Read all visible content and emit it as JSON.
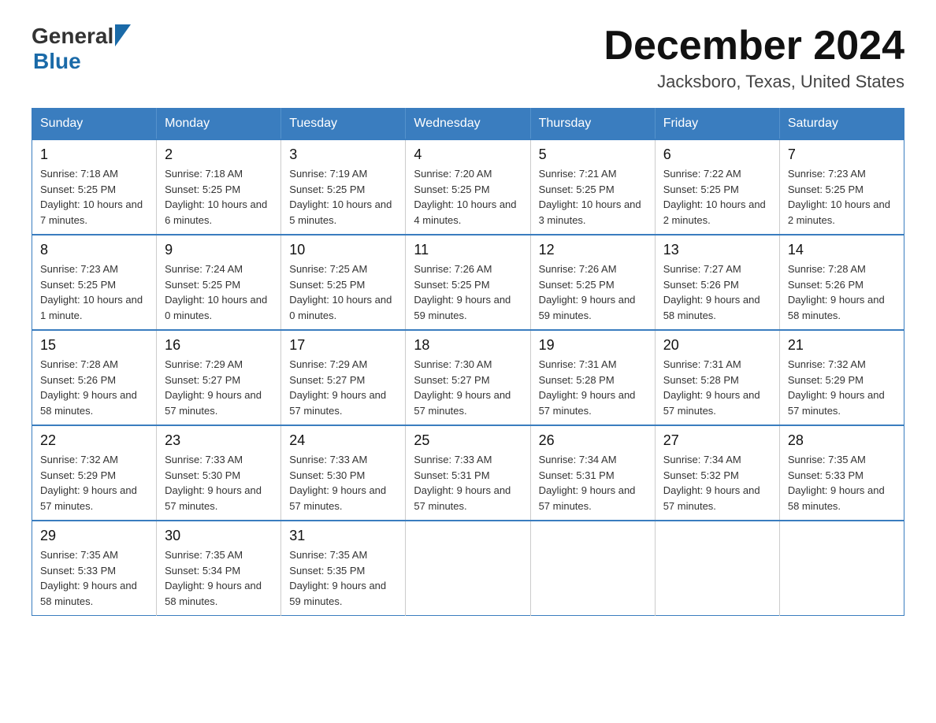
{
  "header": {
    "logo_general": "General",
    "logo_blue": "Blue",
    "title": "December 2024",
    "subtitle": "Jacksboro, Texas, United States"
  },
  "days_of_week": [
    "Sunday",
    "Monday",
    "Tuesday",
    "Wednesday",
    "Thursday",
    "Friday",
    "Saturday"
  ],
  "weeks": [
    [
      {
        "day": "1",
        "sunrise": "7:18 AM",
        "sunset": "5:25 PM",
        "daylight": "10 hours and 7 minutes."
      },
      {
        "day": "2",
        "sunrise": "7:18 AM",
        "sunset": "5:25 PM",
        "daylight": "10 hours and 6 minutes."
      },
      {
        "day": "3",
        "sunrise": "7:19 AM",
        "sunset": "5:25 PM",
        "daylight": "10 hours and 5 minutes."
      },
      {
        "day": "4",
        "sunrise": "7:20 AM",
        "sunset": "5:25 PM",
        "daylight": "10 hours and 4 minutes."
      },
      {
        "day": "5",
        "sunrise": "7:21 AM",
        "sunset": "5:25 PM",
        "daylight": "10 hours and 3 minutes."
      },
      {
        "day": "6",
        "sunrise": "7:22 AM",
        "sunset": "5:25 PM",
        "daylight": "10 hours and 2 minutes."
      },
      {
        "day": "7",
        "sunrise": "7:23 AM",
        "sunset": "5:25 PM",
        "daylight": "10 hours and 2 minutes."
      }
    ],
    [
      {
        "day": "8",
        "sunrise": "7:23 AM",
        "sunset": "5:25 PM",
        "daylight": "10 hours and 1 minute."
      },
      {
        "day": "9",
        "sunrise": "7:24 AM",
        "sunset": "5:25 PM",
        "daylight": "10 hours and 0 minutes."
      },
      {
        "day": "10",
        "sunrise": "7:25 AM",
        "sunset": "5:25 PM",
        "daylight": "10 hours and 0 minutes."
      },
      {
        "day": "11",
        "sunrise": "7:26 AM",
        "sunset": "5:25 PM",
        "daylight": "9 hours and 59 minutes."
      },
      {
        "day": "12",
        "sunrise": "7:26 AM",
        "sunset": "5:25 PM",
        "daylight": "9 hours and 59 minutes."
      },
      {
        "day": "13",
        "sunrise": "7:27 AM",
        "sunset": "5:26 PM",
        "daylight": "9 hours and 58 minutes."
      },
      {
        "day": "14",
        "sunrise": "7:28 AM",
        "sunset": "5:26 PM",
        "daylight": "9 hours and 58 minutes."
      }
    ],
    [
      {
        "day": "15",
        "sunrise": "7:28 AM",
        "sunset": "5:26 PM",
        "daylight": "9 hours and 58 minutes."
      },
      {
        "day": "16",
        "sunrise": "7:29 AM",
        "sunset": "5:27 PM",
        "daylight": "9 hours and 57 minutes."
      },
      {
        "day": "17",
        "sunrise": "7:29 AM",
        "sunset": "5:27 PM",
        "daylight": "9 hours and 57 minutes."
      },
      {
        "day": "18",
        "sunrise": "7:30 AM",
        "sunset": "5:27 PM",
        "daylight": "9 hours and 57 minutes."
      },
      {
        "day": "19",
        "sunrise": "7:31 AM",
        "sunset": "5:28 PM",
        "daylight": "9 hours and 57 minutes."
      },
      {
        "day": "20",
        "sunrise": "7:31 AM",
        "sunset": "5:28 PM",
        "daylight": "9 hours and 57 minutes."
      },
      {
        "day": "21",
        "sunrise": "7:32 AM",
        "sunset": "5:29 PM",
        "daylight": "9 hours and 57 minutes."
      }
    ],
    [
      {
        "day": "22",
        "sunrise": "7:32 AM",
        "sunset": "5:29 PM",
        "daylight": "9 hours and 57 minutes."
      },
      {
        "day": "23",
        "sunrise": "7:33 AM",
        "sunset": "5:30 PM",
        "daylight": "9 hours and 57 minutes."
      },
      {
        "day": "24",
        "sunrise": "7:33 AM",
        "sunset": "5:30 PM",
        "daylight": "9 hours and 57 minutes."
      },
      {
        "day": "25",
        "sunrise": "7:33 AM",
        "sunset": "5:31 PM",
        "daylight": "9 hours and 57 minutes."
      },
      {
        "day": "26",
        "sunrise": "7:34 AM",
        "sunset": "5:31 PM",
        "daylight": "9 hours and 57 minutes."
      },
      {
        "day": "27",
        "sunrise": "7:34 AM",
        "sunset": "5:32 PM",
        "daylight": "9 hours and 57 minutes."
      },
      {
        "day": "28",
        "sunrise": "7:35 AM",
        "sunset": "5:33 PM",
        "daylight": "9 hours and 58 minutes."
      }
    ],
    [
      {
        "day": "29",
        "sunrise": "7:35 AM",
        "sunset": "5:33 PM",
        "daylight": "9 hours and 58 minutes."
      },
      {
        "day": "30",
        "sunrise": "7:35 AM",
        "sunset": "5:34 PM",
        "daylight": "9 hours and 58 minutes."
      },
      {
        "day": "31",
        "sunrise": "7:35 AM",
        "sunset": "5:35 PM",
        "daylight": "9 hours and 59 minutes."
      },
      null,
      null,
      null,
      null
    ]
  ],
  "labels": {
    "sunrise_prefix": "Sunrise: ",
    "sunset_prefix": "Sunset: ",
    "daylight_prefix": "Daylight: "
  }
}
